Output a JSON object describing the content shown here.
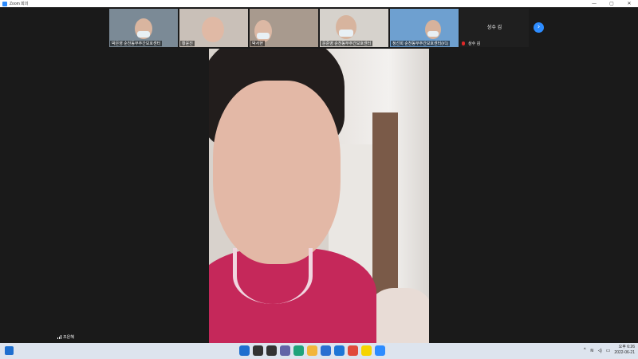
{
  "window": {
    "title": "Zoom 회의",
    "controls": [
      "—",
      "▢",
      "✕"
    ]
  },
  "participants": [
    {
      "name": "박은영 순천동부주간보호센터",
      "bg": "#7b8a96",
      "face": "#d9b59f"
    },
    {
      "name": "황윤진",
      "bg": "#c9c0b8",
      "face": "#e0b9a5"
    },
    {
      "name": "박서현",
      "bg": "#a89a8e",
      "face": "#dcb8a4"
    },
    {
      "name": "문준영 순천동부주간보호센터",
      "bg": "#d6d2cc",
      "face": "#d7b49e"
    },
    {
      "name": "정선희 순천동부주간보호센터(#1)",
      "bg": "#6ea0d0",
      "face": "#d6b29c"
    }
  ],
  "no_video_tile": {
    "center_name": "상수 김",
    "label": "상수 김"
  },
  "next_page_icon": "chevron-right-icon",
  "active_speaker": {
    "name": "조은혜"
  },
  "taskbar": {
    "apps": [
      {
        "icon": "windows-icon",
        "color": "#1e6fcf"
      },
      {
        "icon": "search-icon",
        "color": "#333333"
      },
      {
        "icon": "task-view-icon",
        "color": "#333333"
      },
      {
        "icon": "chat-icon",
        "color": "#6264a7"
      },
      {
        "icon": "edge-icon",
        "color": "#1fa37a"
      },
      {
        "icon": "folder-icon",
        "color": "#f2b53a"
      },
      {
        "icon": "store-icon",
        "color": "#2a6fd1"
      },
      {
        "icon": "mail-icon",
        "color": "#1e76d6"
      },
      {
        "icon": "chrome-icon",
        "color": "#e04a3b"
      },
      {
        "icon": "kakaotalk-icon",
        "color": "#f6d400"
      },
      {
        "icon": "zoom-icon",
        "color": "#2d8cff"
      }
    ],
    "tray": {
      "time": "오후 6:26",
      "date": "2022-06-21"
    }
  }
}
